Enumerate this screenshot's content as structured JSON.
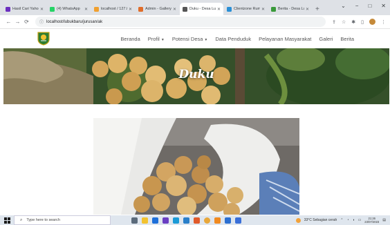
{
  "browser": {
    "tabs": [
      {
        "label": "Hasil Cari Yahoo",
        "favicon_color": "#6b2fbf",
        "active": false
      },
      {
        "label": "(4) WhatsApp",
        "favicon_color": "#25d366",
        "active": false
      },
      {
        "label": "localhost / 127.0",
        "favicon_color": "#f0a030",
        "active": false
      },
      {
        "label": "Admin - Gallery",
        "favicon_color": "#e06d2a",
        "active": false
      },
      {
        "label": "Duku - Desa Lub",
        "favicon_color": "#555555",
        "active": true
      },
      {
        "label": "Clientzone Rumi",
        "favicon_color": "#2a8fd6",
        "active": false
      },
      {
        "label": "Berita - Desa Lul",
        "favicon_color": "#3a9a3a",
        "active": false
      }
    ],
    "new_tab_label": "+",
    "url": "localhost/lubukbaru/jurusan/ak",
    "window_controls": {
      "minimize": "−",
      "maximize": "□",
      "close": "✕",
      "chevron": "⌄"
    }
  },
  "site": {
    "nav": [
      {
        "label": "Beranda",
        "has_dropdown": false
      },
      {
        "label": "Profil",
        "has_dropdown": true
      },
      {
        "label": "Potensi Desa",
        "has_dropdown": true
      },
      {
        "label": "Data Penduduk",
        "has_dropdown": false
      },
      {
        "label": "Pelayanan Masyarakat",
        "has_dropdown": false
      },
      {
        "label": "Galeri",
        "has_dropdown": false
      },
      {
        "label": "Berita",
        "has_dropdown": false
      }
    ],
    "hero_title": "Duku"
  },
  "taskbar": {
    "search_placeholder": "Type here to search",
    "weather": "33°C  Sebagian cerah",
    "time": "21:26",
    "date": "23/07/2023"
  },
  "colors": {
    "hero_green": "#3f5a2a",
    "duku_fruit": "#d9b066",
    "chrome_bg": "#dee1e6"
  }
}
